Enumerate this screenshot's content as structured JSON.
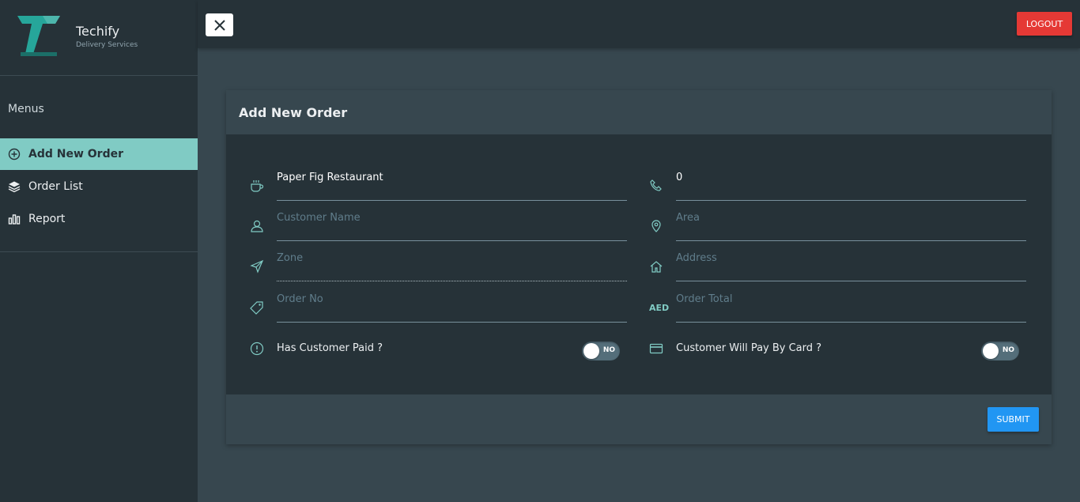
{
  "brand": {
    "name": "Techify",
    "subtitle": "Delivery Services"
  },
  "sidebar": {
    "menus_title": "Menus",
    "items": [
      {
        "label": "Add New Order",
        "icon": "plus-circle-icon",
        "active": true
      },
      {
        "label": "Order List",
        "icon": "layers-icon",
        "active": false
      },
      {
        "label": "Report",
        "icon": "bar-chart-icon",
        "active": false
      }
    ]
  },
  "topbar": {
    "close_icon": "close-icon",
    "logout_label": "LOGOUT"
  },
  "card": {
    "title": "Add New Order",
    "fields": {
      "restaurant": {
        "value": "Paper Fig Restaurant",
        "placeholder": ""
      },
      "phone": {
        "value": "0",
        "placeholder": ""
      },
      "customer_name": {
        "value": "",
        "placeholder": "Customer Name"
      },
      "area": {
        "value": "",
        "placeholder": "Area"
      },
      "zone": {
        "value": "",
        "placeholder": "Zone"
      },
      "address": {
        "value": "",
        "placeholder": "Address"
      },
      "order_no": {
        "value": "",
        "placeholder": "Order No"
      },
      "order_total": {
        "value": "",
        "placeholder": "Order Total",
        "prefix": "AED"
      }
    },
    "toggles": {
      "has_paid": {
        "label": "Has Customer Paid ?",
        "value": "NO"
      },
      "pay_by_card": {
        "label": "Customer Will Pay By Card ?",
        "value": "NO"
      }
    },
    "submit_label": "SUBMIT"
  },
  "colors": {
    "sidebar_bg": "#263238",
    "content_bg": "#37474f",
    "accent": "#80cbc4",
    "logout": "#e53935",
    "submit": "#2196f3"
  }
}
